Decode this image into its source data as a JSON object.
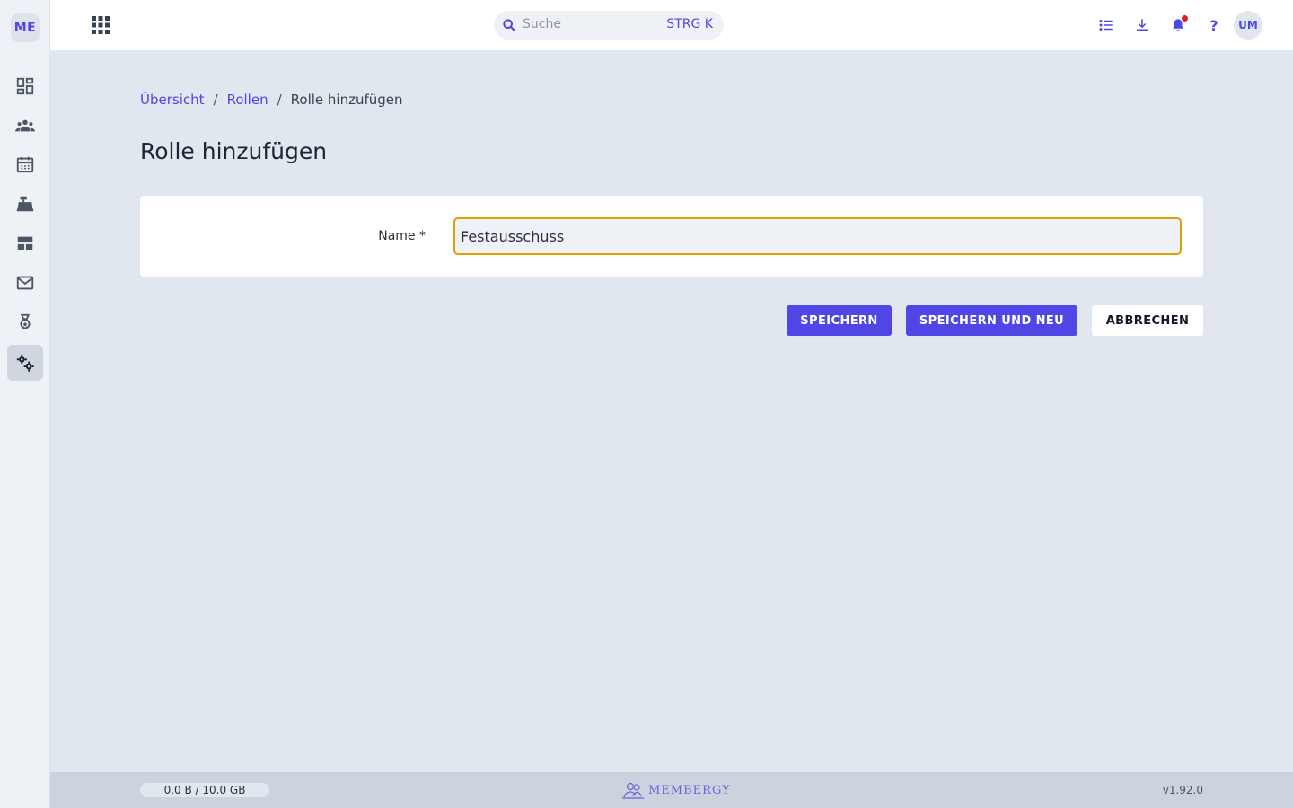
{
  "sidebar": {
    "logo": "ME",
    "items": [
      {
        "name": "dashboard",
        "icon": "dashboard-icon"
      },
      {
        "name": "members",
        "icon": "people-icon"
      },
      {
        "name": "calendar",
        "icon": "calendar-icon"
      },
      {
        "name": "cash-register",
        "icon": "cash-register-icon"
      },
      {
        "name": "layout",
        "icon": "table-icon"
      },
      {
        "name": "mail",
        "icon": "mail-icon"
      },
      {
        "name": "awards",
        "icon": "medal-icon"
      },
      {
        "name": "settings",
        "icon": "gears-icon",
        "active": true
      }
    ]
  },
  "topbar": {
    "search_placeholder": "Suche",
    "search_shortcut": "STRG K",
    "help": "?",
    "avatar": "UM"
  },
  "breadcrumb": {
    "items": [
      "Übersicht",
      "Rollen"
    ],
    "current": "Rolle hinzufügen",
    "separator": "/"
  },
  "page_title": "Rolle hinzufügen",
  "form": {
    "name_label": "Name *",
    "name_value": "Festausschuss"
  },
  "actions": {
    "save": "SPEICHERN",
    "save_and_new": "SPEICHERN UND NEU",
    "cancel": "ABBRECHEN"
  },
  "footer": {
    "storage": "0.0 B / 10.0 GB",
    "brand": "MEMBERGY",
    "version": "v1.92.0"
  },
  "colors": {
    "accent": "#4f46e5",
    "focus_border": "#e0a000",
    "notification": "#e11d2e"
  }
}
